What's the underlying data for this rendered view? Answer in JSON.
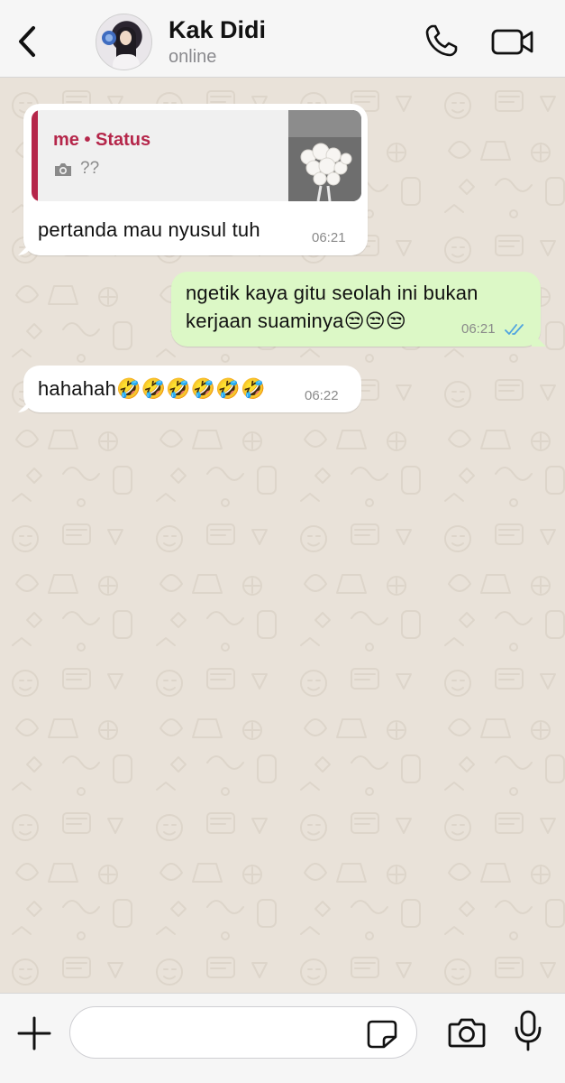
{
  "header": {
    "back_icon": "chevron-left-icon",
    "contact_name": "Kak Didi",
    "contact_status": "online",
    "call_icon": "phone-icon",
    "video_icon": "video-camera-icon"
  },
  "messages": [
    {
      "direction": "incoming",
      "quote": {
        "author": "me • Status",
        "icon": "camera-icon",
        "text": "??",
        "thumbnail": "white-rose-bouquet-photo"
      },
      "text": "pertanda mau nyusul tuh",
      "time": "06:21"
    },
    {
      "direction": "outgoing",
      "text_line1": "ngetik kaya gitu seolah ini bukan",
      "text_line2": "kerjaan suaminya😒😒😒",
      "time": "06:21",
      "status_icon": "double-check-read-icon"
    },
    {
      "direction": "incoming",
      "text": "hahahah🤣🤣🤣🤣🤣🤣",
      "time": "06:22"
    }
  ],
  "composer": {
    "plus_icon": "plus-icon",
    "input_value": "",
    "sticker_icon": "sticker-icon",
    "camera_icon": "camera-icon",
    "mic_icon": "microphone-icon"
  },
  "colors": {
    "background": "#e9e2d9",
    "incoming_bubble": "#ffffff",
    "outgoing_bubble": "#dcf8c6",
    "quote_accent": "#b5264a",
    "read_ticks": "#4fa3e0"
  }
}
